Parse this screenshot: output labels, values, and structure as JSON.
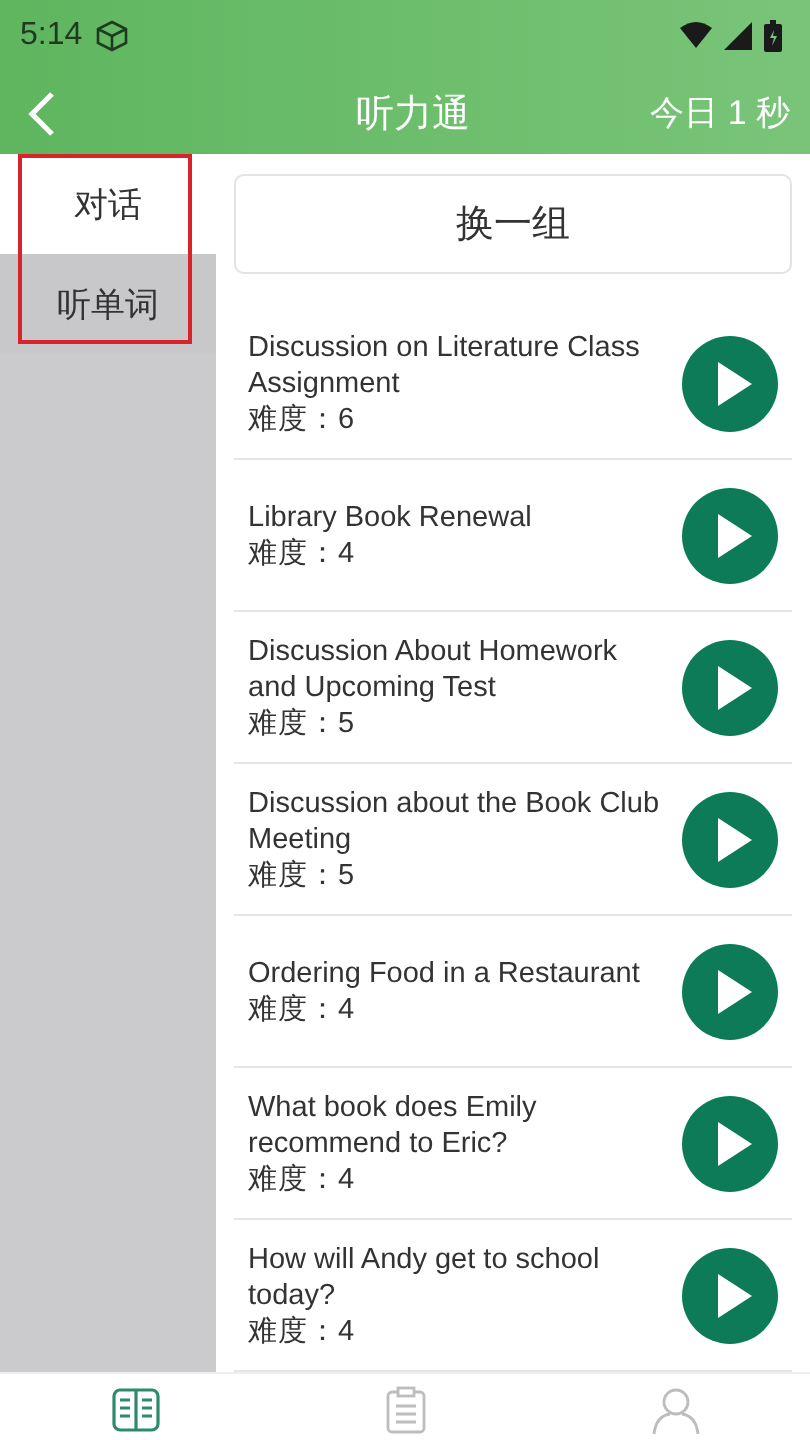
{
  "status_bar": {
    "time": "5:14"
  },
  "header": {
    "title": "听力通",
    "today": "今日 1 秒"
  },
  "sidebar": {
    "items": [
      {
        "label": "对话",
        "selected": true
      },
      {
        "label": "听单词",
        "selected": false
      }
    ]
  },
  "shuffle_button": "换一组",
  "lessons": [
    {
      "title": "Discussion on Literature Class Assignment",
      "difficulty": "难度：6"
    },
    {
      "title": "Library Book Renewal",
      "difficulty": "难度：4"
    },
    {
      "title": "Discussion About Homework and Upcoming Test",
      "difficulty": "难度：5"
    },
    {
      "title": "Discussion about the Book Club Meeting",
      "difficulty": "难度：5"
    },
    {
      "title": "Ordering Food in a Restaurant",
      "difficulty": "难度：4"
    },
    {
      "title": "What book does Emily recommend to Eric?",
      "difficulty": "难度：4"
    },
    {
      "title": "How will Andy get to school today?",
      "difficulty": "难度：4"
    }
  ],
  "bottom_nav": [
    {
      "kind": "book",
      "selected": true
    },
    {
      "kind": "clipboard",
      "selected": false
    },
    {
      "kind": "person",
      "selected": false
    }
  ]
}
